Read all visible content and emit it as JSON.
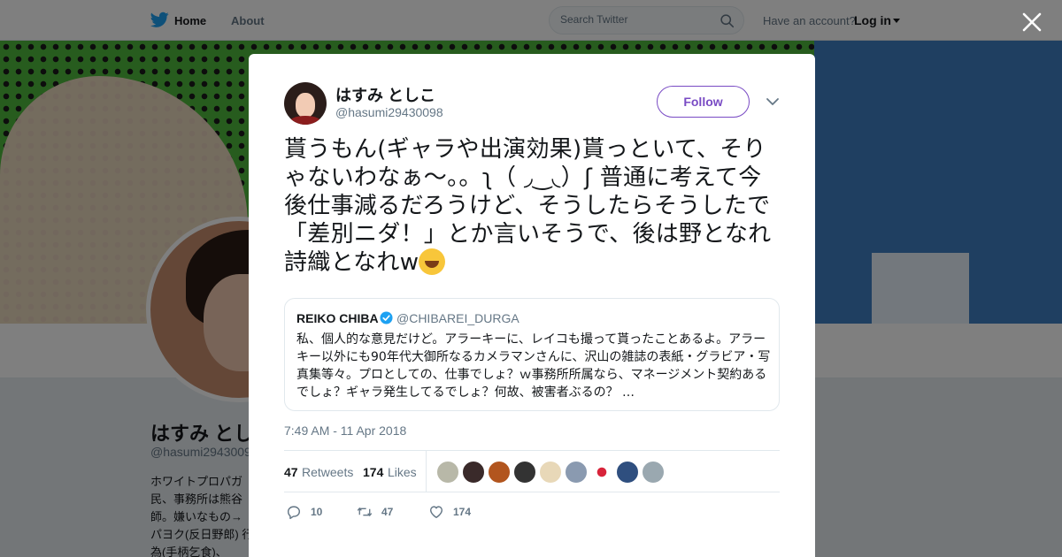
{
  "nav": {
    "home_label": "Home",
    "about_label": "About",
    "search_placeholder": "Search Twitter",
    "account_question": "Have an account?",
    "login_label": "Log in"
  },
  "profile": {
    "display_name": "はすみ とし",
    "handle": "@hasumi2943009",
    "bio": "ホワイトプロパガ 民、事務所は熊谷 師。嫌いなもの→ パヨク(反日野郎) 行為(手柄乞食)、"
  },
  "tweet": {
    "author_name": "はすみ としこ",
    "author_handle": "@hasumi29430098",
    "follow_label": "Follow",
    "text": "貰うもん(ギャラや出演効果)貰っといて、そりゃないわなぁ〜。。ʅ（ ◞‿◟）ʃ 普通に考えて今後仕事減るだろうけど、そうしたらそうしたで「差別ニダ！」とか言いそうで、後は野となれ詩織となれw",
    "emoji": "rolling-on-the-floor-laughing-emoji",
    "quoted": {
      "name": "REIKO CHIBA",
      "handle": "@CHIBAREI_DURGA",
      "text": "私、個人的な意見だけど。アラーキーに、レイコも撮って貰ったことあるよ。アラーキー以外にも90年代大御所なるカメラマンさんに、沢山の雑誌の表紙・グラビア・写真集等々。プロとしての、仕事でしょ？ｗ事務所所属なら、マネージメント契約あるでしょ？ギャラ発生してるでしょ？何故、被害者ぶるの？ …",
      "verified": true
    },
    "timestamp": "7:49 AM - 11 Apr 2018",
    "retweets_count": "47",
    "retweets_label": "Retweets",
    "likes_count": "174",
    "likes_label": "Likes",
    "liker_colors": [
      "#b8b8a8",
      "#3a2a2a",
      "#b2551e",
      "#333333",
      "#e8d8b8",
      "#8a9ab0",
      "#ffffff",
      "#2f4f7f",
      "#9aa8b0"
    ],
    "reply_count": "10",
    "retweet_action_count": "47",
    "like_action_count": "174"
  },
  "colors": {
    "accent": "#794bc4",
    "twitter_blue": "#1da1f2",
    "text_secondary": "#657786"
  }
}
